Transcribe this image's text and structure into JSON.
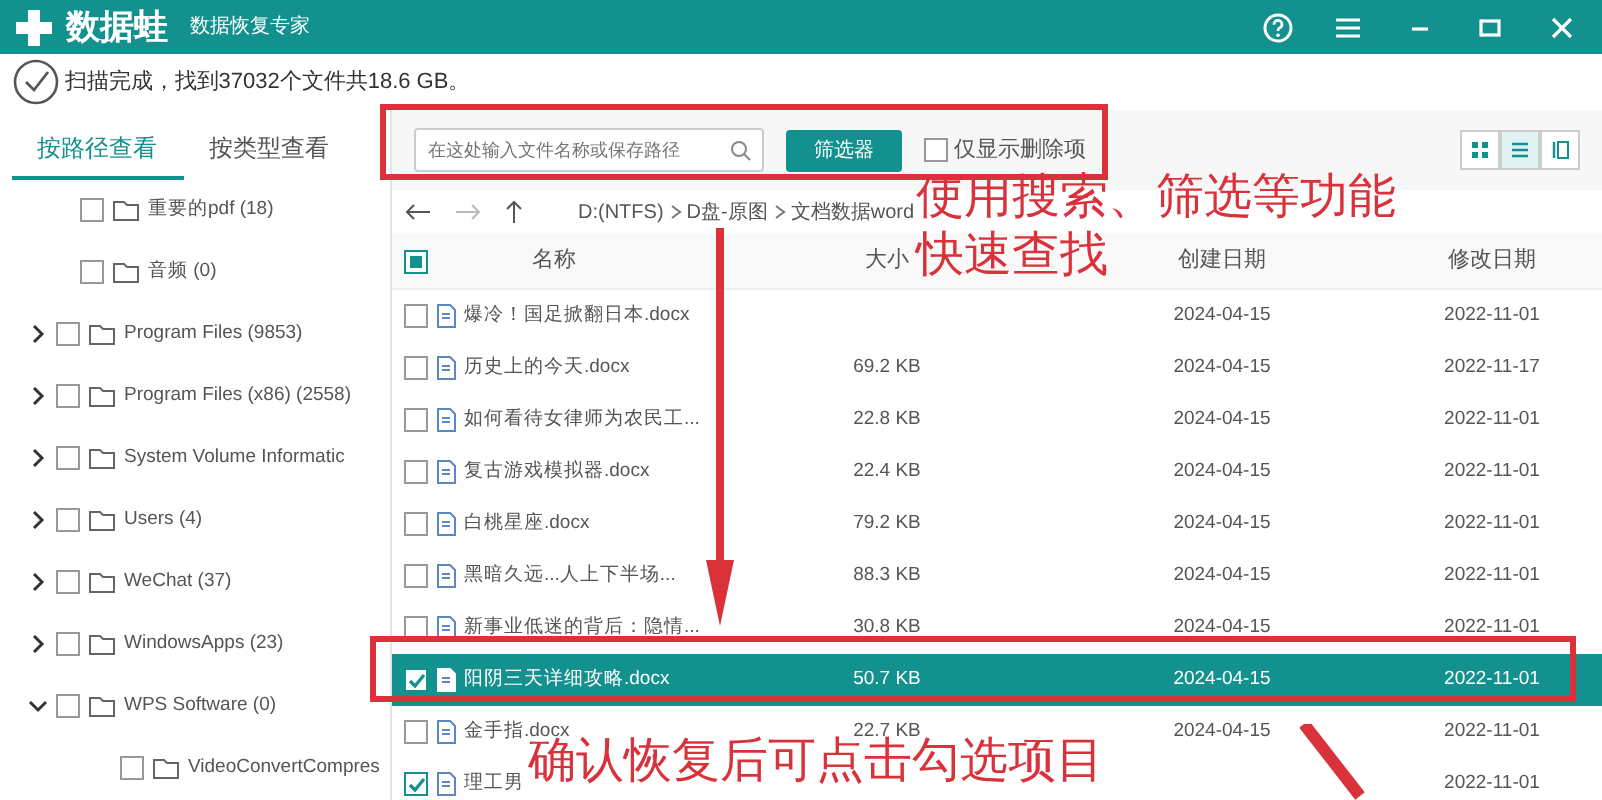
{
  "window": {
    "app_name": "数据蛙",
    "subtitle": "数据恢复专家"
  },
  "status": "扫描完成，找到37032个文件共18.6 GB。",
  "view_tabs": [
    {
      "label": "按路径查看",
      "selected": true
    },
    {
      "label": "按类型查看",
      "selected": false
    }
  ],
  "tree": [
    {
      "label": "重要的pdf (18)",
      "checked": false
    },
    {
      "label": "音频 (0)",
      "checked": false
    },
    {
      "label": "Program Files (9853)",
      "checked": false,
      "expanded": false
    },
    {
      "label": "Program Files (x86) (2558)",
      "checked": false,
      "expanded": false
    },
    {
      "label": "System Volume Informatic",
      "checked": false,
      "expanded": false
    },
    {
      "label": "Users (4)",
      "checked": false,
      "expanded": false
    },
    {
      "label": "WeChat (37)",
      "checked": false,
      "expanded": false
    },
    {
      "label": "WindowsApps (23)",
      "checked": false,
      "expanded": false
    },
    {
      "label": "WPS Software (0)",
      "checked": false,
      "expanded": true,
      "children": [
        {
          "label": "VideoConvertCompres",
          "checked": false
        }
      ]
    }
  ],
  "search": {
    "placeholder": "在这处输入文件名称或保存路径"
  },
  "filter_button": "筛选器",
  "deleted_only": {
    "label": "仅显示删除项",
    "checked": false
  },
  "view_modes": [
    {
      "kind": "grid",
      "selected": false
    },
    {
      "kind": "list",
      "selected": true
    },
    {
      "kind": "detail",
      "selected": false
    }
  ],
  "breadcrumb": [
    "D:(NTFS)",
    "D盘-原图",
    "文档数据word"
  ],
  "table": {
    "header_checkbox": {
      "indeterminate": true
    },
    "columns": [
      "名称",
      "大小",
      "创建日期",
      "修改日期"
    ],
    "rows": [
      {
        "name": "爆冷！国足掀翻日本.docx",
        "created": "2024-04-15",
        "modified": "2022-11-01",
        "checked": false,
        "selected": false
      },
      {
        "name": "历史上的今天.docx",
        "size": "69.2 KB",
        "created": "2024-04-15",
        "modified": "2022-11-17",
        "checked": false,
        "selected": false
      },
      {
        "name": "如何看待女律师为农民工...",
        "size": "22.8 KB",
        "created": "2024-04-15",
        "modified": "2022-11-01",
        "checked": false,
        "selected": false
      },
      {
        "name": "复古游戏模拟器.docx",
        "size": "22.4 KB",
        "created": "2024-04-15",
        "modified": "2022-11-01",
        "checked": false,
        "selected": false
      },
      {
        "name": "白桃星座.docx",
        "size": "79.2 KB",
        "created": "2024-04-15",
        "modified": "2022-11-01",
        "checked": false,
        "selected": false
      },
      {
        "name": "黑暗久远...人上下半场...",
        "size": "88.3 KB",
        "created": "2024-04-15",
        "modified": "2022-11-01",
        "checked": false,
        "selected": false
      },
      {
        "name": "新事业低迷的背后：隐情...",
        "size": "30.8 KB",
        "created": "2024-04-15",
        "modified": "2022-11-01",
        "checked": false,
        "selected": false
      },
      {
        "name": "阳阴三天详细攻略.docx",
        "size": "50.7 KB",
        "created": "2024-04-15",
        "modified": "2022-11-01",
        "checked": true,
        "selected": true
      },
      {
        "name": "金手指.docx",
        "size": "22.7 KB",
        "created": "2024-04-15",
        "modified": "2022-11-01",
        "checked": false,
        "selected": false
      },
      {
        "name": "理工男",
        "modified": "2022-11-01",
        "checked": true,
        "selected": false
      }
    ]
  },
  "annotations": [
    {
      "kind": "note",
      "text": "使用搜索、筛选等功能"
    },
    {
      "kind": "note",
      "text": "快速查找"
    },
    {
      "kind": "note",
      "text": "确认恢复后可点击勾选项目"
    }
  ]
}
